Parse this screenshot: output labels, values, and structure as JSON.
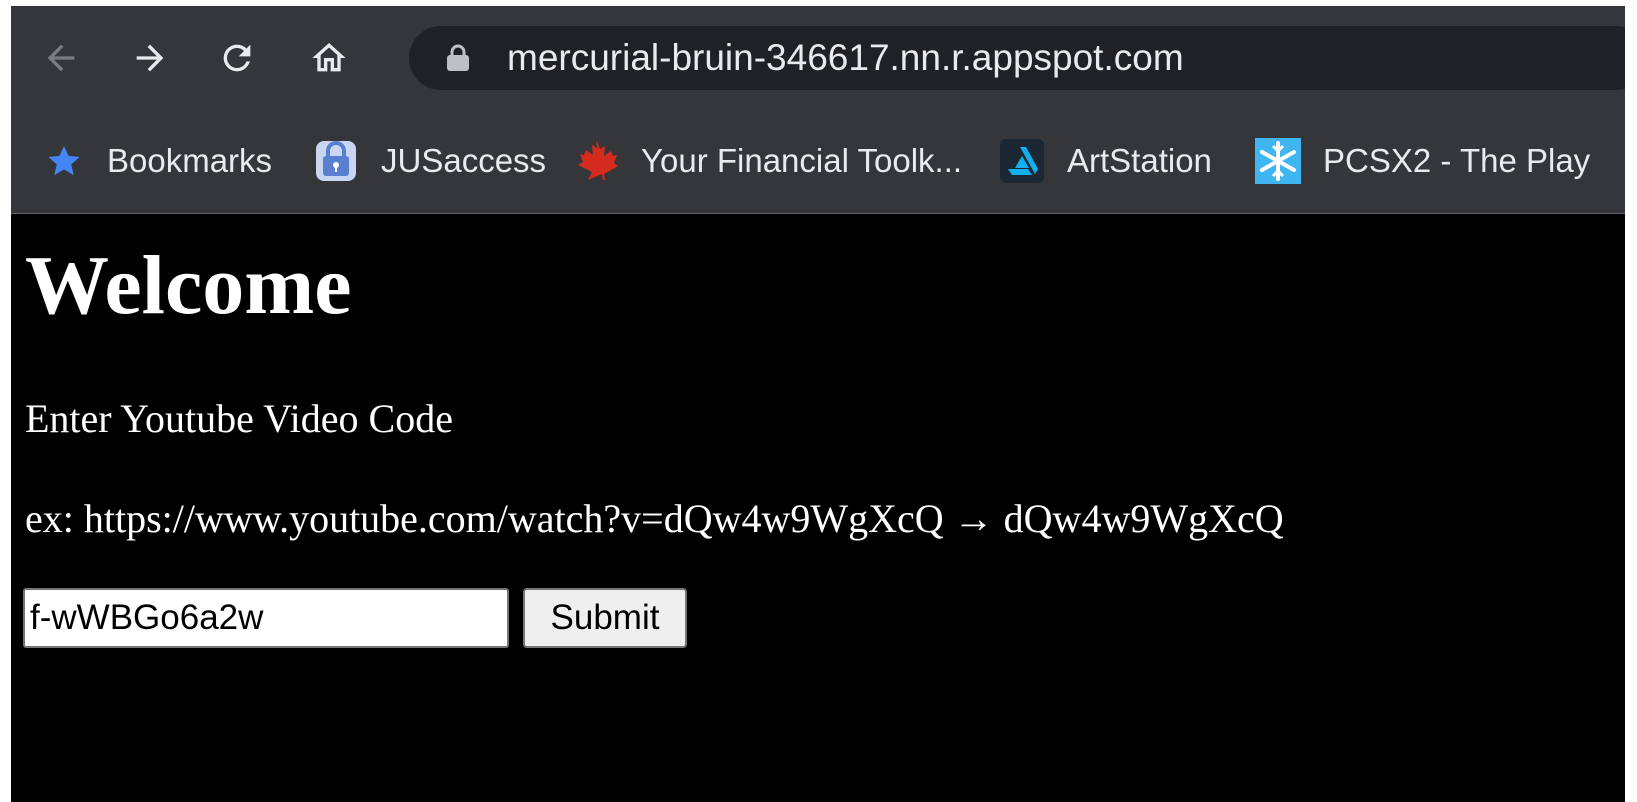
{
  "browser": {
    "address_bar": {
      "url": "mercurial-bruin-346617.nn.r.appspot.com",
      "lock_icon": "lock-icon"
    },
    "nav_icons": [
      "back-arrow-icon",
      "forward-arrow-icon",
      "reload-icon",
      "home-icon"
    ],
    "bookmarks": [
      {
        "label": "Bookmarks",
        "icon": "star-icon",
        "color": "#4285f4"
      },
      {
        "label": "JUSaccess",
        "icon": "lock-badge-icon",
        "color": "#6f8fd8"
      },
      {
        "label": "Your Financial Toolk...",
        "icon": "maple-leaf-icon",
        "color": "#d52b1e"
      },
      {
        "label": "ArtStation",
        "icon": "artstation-icon",
        "color": "#13aff0"
      },
      {
        "label": "PCSX2 - The Play",
        "icon": "snowflake-icon",
        "color": "#3fb6f2"
      }
    ]
  },
  "page": {
    "title": "Welcome",
    "instruction": "Enter Youtube Video Code",
    "example": "ex: https://www.youtube.com/watch?v=dQw4w9WgXcQ → dQw4w9WgXcQ",
    "input_value": "f-wWBGo6a2w",
    "submit_label": "Submit"
  },
  "colors": {
    "chrome_toolbar": "#35363a",
    "omnibox": "#202124",
    "page_background": "#000000",
    "page_text": "#ffffff"
  }
}
